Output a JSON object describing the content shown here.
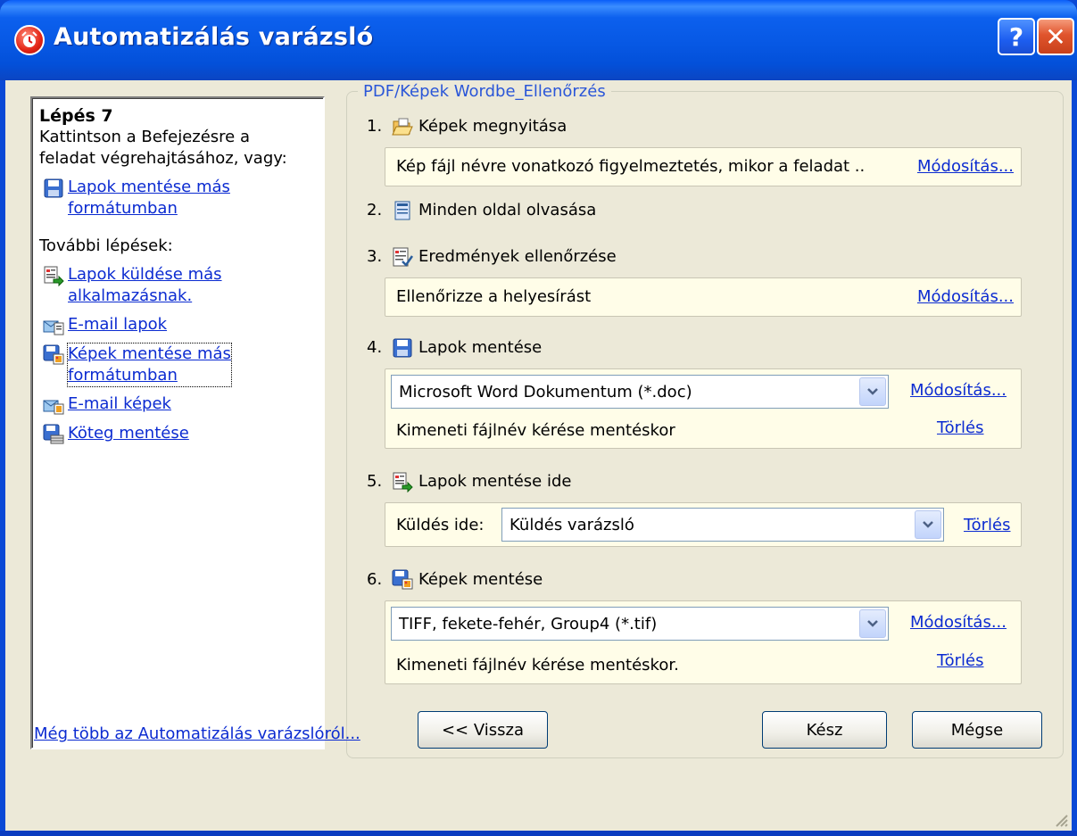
{
  "window": {
    "title": "Automatizálás varázsló",
    "help_button": "?",
    "close_button": "✕"
  },
  "left_panel": {
    "step_title": "Lépés 7",
    "step_desc_line1": "Kattintson a Befejezésre a",
    "step_desc_line2": "feladat végrehajtásához, vagy:",
    "save_link_line1": "Lapok mentése más",
    "save_link_line2": "formátumban",
    "more_steps_label": "További lépések:",
    "items": [
      {
        "line1": "Lapok küldése más",
        "line2": "alkalmazásnak.",
        "icon": "send-pages-icon"
      },
      {
        "line1": "E-mail lapok",
        "line2": "",
        "icon": "email-pages-icon"
      },
      {
        "line1": "Képek mentése más",
        "line2": "formátumban",
        "icon": "save-images-icon"
      },
      {
        "line1": "E-mail képek",
        "line2": "",
        "icon": "email-images-icon"
      },
      {
        "line1": "Köteg mentése",
        "line2": "",
        "icon": "save-batch-icon"
      }
    ]
  },
  "group": {
    "legend": "PDF/Képek Wordbe_Ellenőrzés",
    "step1": {
      "num": "1.",
      "label": "Képek megnyitása",
      "box_text": "Kép fájl névre vonatkozó figyelmeztetés, mikor a feladat ..",
      "link": "Módosítás..."
    },
    "step2": {
      "num": "2.",
      "label": "Minden oldal olvasása"
    },
    "step3": {
      "num": "3.",
      "label": "Eredmények ellenőrzése",
      "box_text": "Ellenőrizze a helyesírást",
      "link": "Módosítás..."
    },
    "step4": {
      "num": "4.",
      "label": "Lapok mentése",
      "combo_value": "Microsoft Word Dokumentum (*.doc)",
      "link_modify": "Módosítás...",
      "note": "Kimeneti fájlnév kérése mentéskor",
      "link_delete": "Törlés"
    },
    "step5": {
      "num": "5.",
      "label": "Lapok mentése ide",
      "send_label": "Küldés ide:",
      "combo_value": "Küldés varázsló",
      "link_delete": "Törlés"
    },
    "step6": {
      "num": "6.",
      "label": "Képek mentése",
      "combo_value": "TIFF, fekete-fehér, Group4 (*.tif)",
      "link_modify": "Módosítás...",
      "note": "Kimeneti fájlnév kérése mentéskor.",
      "link_delete": "Törlés"
    }
  },
  "footer": {
    "more_link": "Még több az Automatizálás varázslóról...",
    "back_button": "<< Vissza",
    "finish_button": "Kész",
    "cancel_button": "Mégse"
  }
}
